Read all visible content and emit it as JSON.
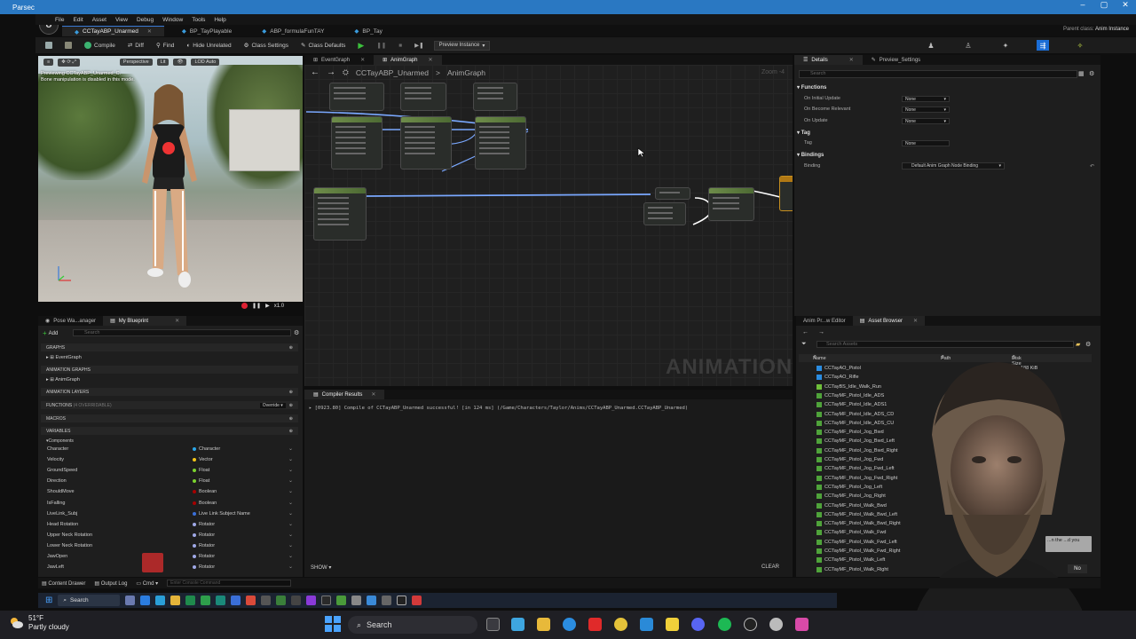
{
  "parsec": {
    "title": "Parsec",
    "controls": [
      "–",
      "▢",
      "✕"
    ]
  },
  "menu": [
    "File",
    "Edit",
    "Asset",
    "View",
    "Debug",
    "Window",
    "Tools",
    "Help"
  ],
  "tabs": [
    {
      "label": "CCTayABP_Unarmed",
      "active": true
    },
    {
      "label": "BP_TayPlayable",
      "active": false
    },
    {
      "label": "ABP_formulaFunTAY",
      "active": false
    },
    {
      "label": "BP_Tay",
      "active": false
    }
  ],
  "parent_class": {
    "label": "Parent class:",
    "value": "Anim Instance"
  },
  "toolbar": {
    "compile": "Compile",
    "diff": "Diff",
    "find": "Find",
    "hide_unrelated": "Hide Unrelated",
    "class_settings": "Class Settings",
    "class_defaults": "Class Defaults",
    "preview_instance": "Preview Instance"
  },
  "viewport": {
    "perspective": "Perspective",
    "lit": "Lit",
    "lod": "LOD Auto",
    "msg_line1": "Previewing CCTayABP_Unarmed_C.",
    "msg_line2": "Bone manipulation is disabled in this mode.",
    "speed": "x1.0"
  },
  "graph": {
    "tabs": [
      "EventGraph",
      "AnimGraph"
    ],
    "active_tab": "AnimGraph",
    "breadcrumb_root": "CCTayABP_Unarmed",
    "breadcrumb_leaf": "AnimGraph",
    "zoom": "Zoom -4",
    "watermark": "ANIMATION"
  },
  "details": {
    "tabs": [
      "Details",
      "Preview_Settings"
    ],
    "search_placeholder": "Search",
    "functions_header": "Functions",
    "on_initial_update": "On Initial Update",
    "on_become_relevant": "On Become Relevant",
    "on_update": "On Update",
    "none": "None",
    "tag_header": "Tag",
    "tag_label": "Tag",
    "bindings_header": "Bindings",
    "binding_label": "Binding",
    "binding_value": "Default Anim Graph Node Binding"
  },
  "left_panel": {
    "tabs": [
      "Pose Wa...anager",
      "My Blueprint"
    ],
    "add": "Add",
    "search_placeholder": "Search",
    "graphs_header": "GRAPHS",
    "event_graph": "EventGraph",
    "anim_graphs_header": "ANIMATION GRAPHS",
    "anim_graph": "AnimGraph",
    "anim_layers_header": "ANIMATION LAYERS",
    "functions_header": "FUNCTIONS",
    "functions_count": "(4 OVERRIDABLE)",
    "override": "Override",
    "macros_header": "MACROS",
    "variables_header": "VARIABLES",
    "components_header": "Components",
    "variables": [
      {
        "name": "Character",
        "type": "Character",
        "color": "#2aa6e8"
      },
      {
        "name": "Velocity",
        "type": "Vector",
        "color": "#f4c518"
      },
      {
        "name": "GroundSpeed",
        "type": "Float",
        "color": "#7bd32e"
      },
      {
        "name": "Direction",
        "type": "Float",
        "color": "#7bd32e"
      },
      {
        "name": "ShouldMove",
        "type": "Boolean",
        "color": "#a60000"
      },
      {
        "name": "IsFalling",
        "type": "Boolean",
        "color": "#a60000"
      },
      {
        "name": "LiveLink_Subj",
        "type": "Live Link Subject Name",
        "color": "#3a6fd8"
      },
      {
        "name": "Head Rotation",
        "type": "Rotator",
        "color": "#9fa8e6"
      },
      {
        "name": "Upper Neck Rotation",
        "type": "Rotator",
        "color": "#9fa8e6"
      },
      {
        "name": "Lower Neck Rotation",
        "type": "Rotator",
        "color": "#9fa8e6"
      },
      {
        "name": "JawOpen",
        "type": "Rotator",
        "color": "#9fa8e6"
      },
      {
        "name": "JawLeft",
        "type": "Rotator",
        "color": "#9fa8e6"
      }
    ]
  },
  "compiler": {
    "tab": "Compiler Results",
    "message": "[0923.80] Compile of CCTayABP_Unarmed successful! [in 124 ms] (/Game/Characters/Taylor/Anims/CCTayABP_Unarmed.CCTayABP_Unarmed)",
    "show": "SHOW",
    "clear": "CLEAR"
  },
  "asset_browser": {
    "tabs": [
      "Anim Pr...w Editor",
      "Asset Browser"
    ],
    "search_placeholder": "Search Assets",
    "col_name": "Name",
    "col_path": "Path",
    "col_size": "Disk Size",
    "rows": [
      {
        "name": "CCTayAO_Pistol",
        "color": "#2a8ce0",
        "size": "188 KiB"
      },
      {
        "name": "CCTayAO_Rifle",
        "color": "#2a8ce0",
        "size": "KiB"
      },
      {
        "name": "CCTayBS_Idle_Walk_Run",
        "color": "#6fbf3a",
        "size": "KiB"
      },
      {
        "name": "CCTayMF_Pistol_Idle_ADS",
        "color": "#4fa33a",
        "size": ""
      },
      {
        "name": "CCTayMF_Pistol_Idle_ADS1",
        "color": "#4fa33a",
        "size": ""
      },
      {
        "name": "CCTayMF_Pistol_Idle_ADS_CD",
        "color": "#4fa33a",
        "size": ""
      },
      {
        "name": "CCTayMF_Pistol_Idle_ADS_CU",
        "color": "#4fa33a",
        "size": ""
      },
      {
        "name": "CCTayMF_Pistol_Jog_Bwd",
        "color": "#4fa33a",
        "size": ""
      },
      {
        "name": "CCTayMF_Pistol_Jog_Bwd_Left",
        "color": "#4fa33a",
        "size": ""
      },
      {
        "name": "CCTayMF_Pistol_Jog_Bwd_Right",
        "color": "#4fa33a",
        "size": ""
      },
      {
        "name": "CCTayMF_Pistol_Jog_Fwd",
        "color": "#4fa33a",
        "size": ""
      },
      {
        "name": "CCTayMF_Pistol_Jog_Fwd_Left",
        "color": "#4fa33a",
        "size": ""
      },
      {
        "name": "CCTayMF_Pistol_Jog_Fwd_Right",
        "color": "#4fa33a",
        "size": ""
      },
      {
        "name": "CCTayMF_Pistol_Jog_Left",
        "color": "#4fa33a",
        "size": ""
      },
      {
        "name": "CCTayMF_Pistol_Jog_Right",
        "color": "#4fa33a",
        "size": ""
      },
      {
        "name": "CCTayMF_Pistol_Walk_Bwd",
        "color": "#4fa33a",
        "size": ""
      },
      {
        "name": "CCTayMF_Pistol_Walk_Bwd_Left",
        "color": "#4fa33a",
        "size": ""
      },
      {
        "name": "CCTayMF_Pistol_Walk_Bwd_Right",
        "color": "#4fa33a",
        "size": ""
      },
      {
        "name": "CCTayMF_Pistol_Walk_Fwd",
        "color": "#4fa33a",
        "size": ""
      },
      {
        "name": "CCTayMF_Pistol_Walk_Fwd_Left",
        "color": "#4fa33a",
        "size": ""
      },
      {
        "name": "CCTayMF_Pistol_Walk_Fwd_Right",
        "color": "#4fa33a",
        "size": ""
      },
      {
        "name": "CCTayMF_Pistol_Walk_Left",
        "color": "#4fa33a",
        "size": ""
      },
      {
        "name": "CCTayMF_Pistol_Walk_Right",
        "color": "#4fa33a",
        "size": ""
      }
    ]
  },
  "status_bar": {
    "content_drawer": "Content Drawer",
    "output_log": "Output Log",
    "cmd": "Cmd",
    "console_placeholder": "Enter Console Command"
  },
  "vm_taskbar": {
    "search": "Search"
  },
  "host_taskbar": {
    "temp": "51°F",
    "weather": "Partly cloudy",
    "search": "Search"
  },
  "webcam": {
    "prompt": "...n the ...d you",
    "no": "No"
  }
}
